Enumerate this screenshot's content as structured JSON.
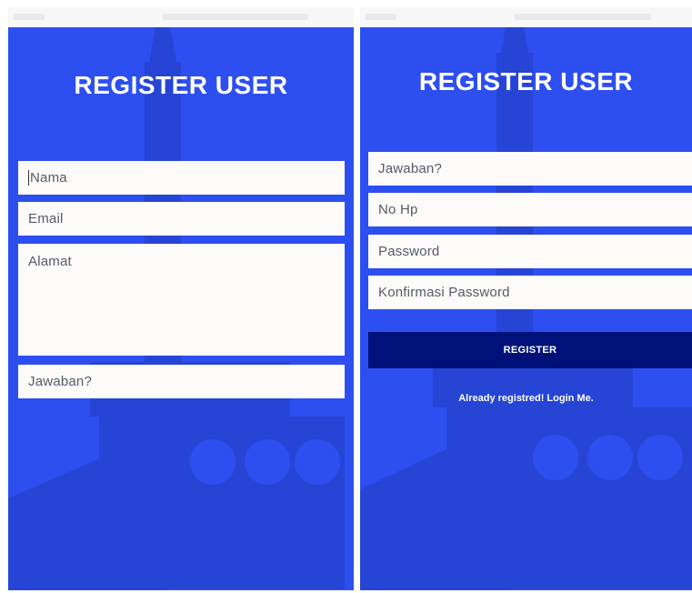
{
  "colors": {
    "background_blue": "#2d4ff0",
    "field_background": "#fdfafa",
    "button_background": "#00127a",
    "title_text": "#ffffff"
  },
  "left_screen": {
    "title": "REGISTER USER",
    "fields": {
      "nama": "Nama",
      "email": "Email",
      "alamat": "Alamat",
      "jawaban": "Jawaban?"
    }
  },
  "right_screen": {
    "title": "REGISTER USER",
    "fields": {
      "jawaban": "Jawaban?",
      "no_hp": "No Hp",
      "password": "Password",
      "konfirmasi_password": "Konfirmasi Password"
    },
    "register_button": "REGISTER",
    "login_link": "Already registred! Login Me."
  },
  "background_image": {
    "icon": "menara-gentala-arasy-building"
  }
}
